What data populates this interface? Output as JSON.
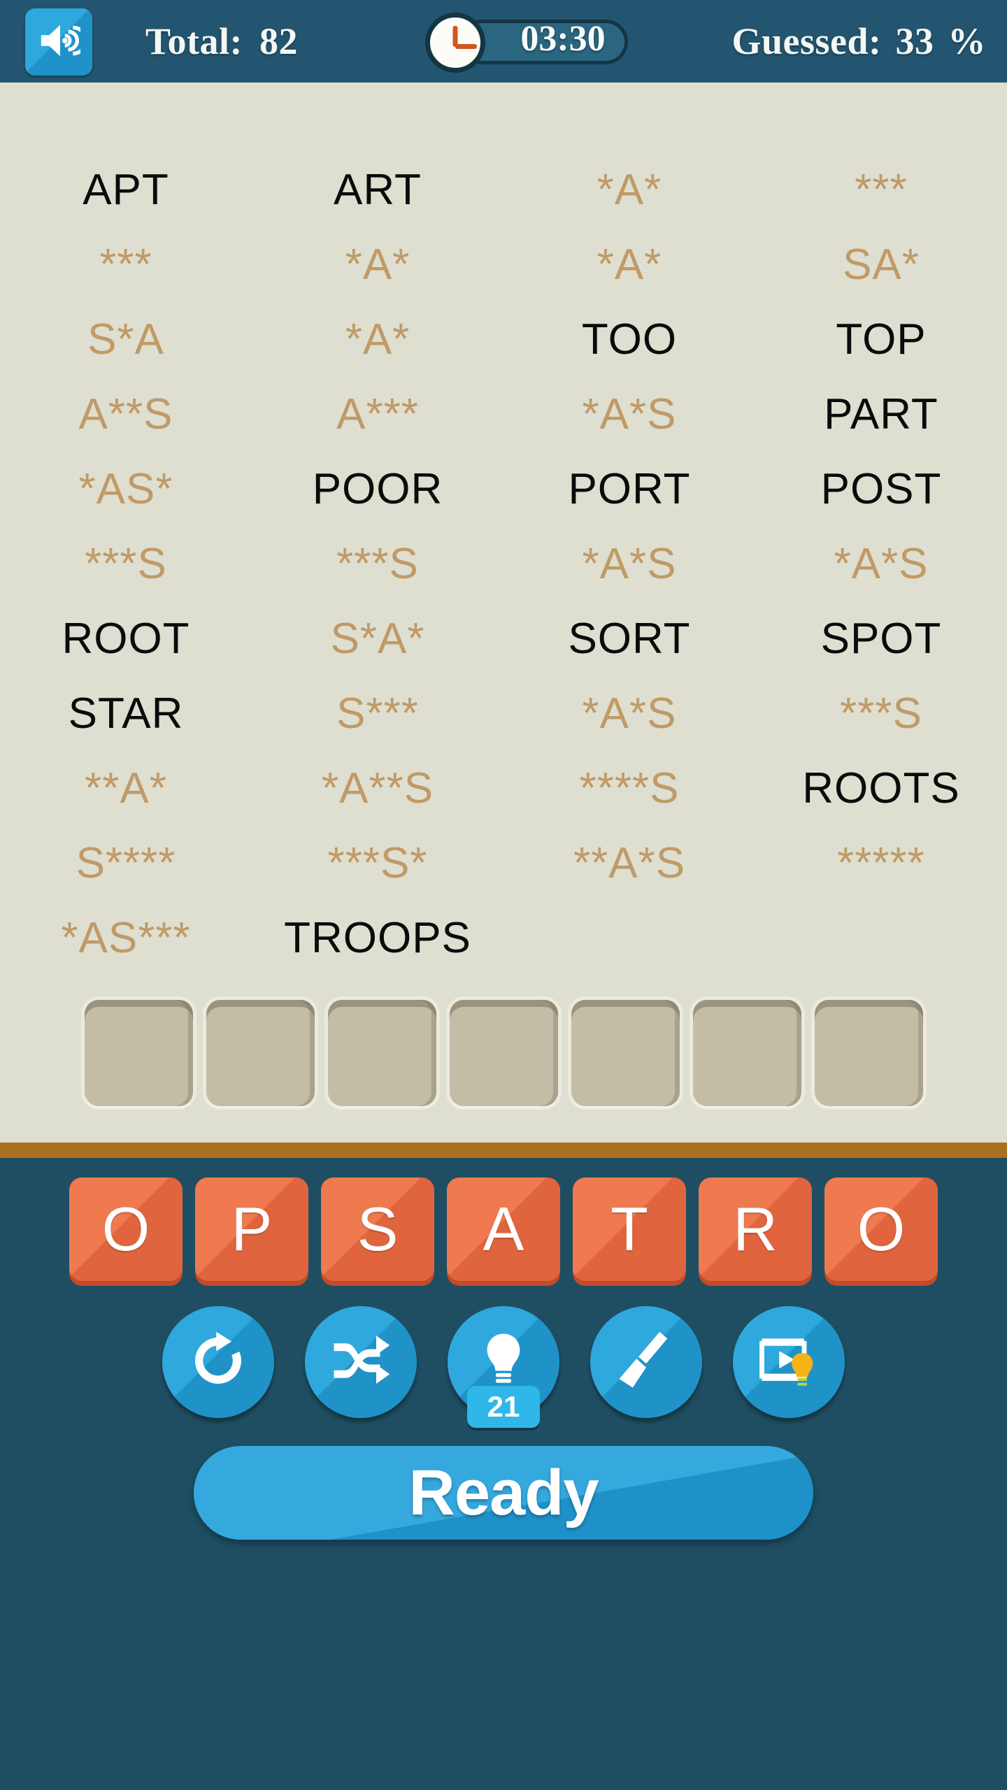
{
  "header": {
    "sound_icon": "speaker-on-icon",
    "total_label": "Total:",
    "total_value": "82",
    "clock_icon": "clock-icon",
    "timer_value": "03:30",
    "guessed_label": "Guessed:",
    "guessed_value": "33",
    "percent_symbol": "%"
  },
  "board": {
    "background_color": "#dedfd0",
    "solved_color": "#0b0b0b",
    "hidden_color": "#c09a67",
    "columns": 4,
    "words": [
      {
        "text": "APT",
        "solved": true
      },
      {
        "text": "ART",
        "solved": true
      },
      {
        "text": "*A*",
        "solved": false
      },
      {
        "text": "***",
        "solved": false
      },
      {
        "text": "***",
        "solved": false
      },
      {
        "text": "*A*",
        "solved": false
      },
      {
        "text": "*A*",
        "solved": false
      },
      {
        "text": "SA*",
        "solved": false
      },
      {
        "text": "S*A",
        "solved": false
      },
      {
        "text": "*A*",
        "solved": false
      },
      {
        "text": "TOO",
        "solved": true
      },
      {
        "text": "TOP",
        "solved": true
      },
      {
        "text": "A**S",
        "solved": false
      },
      {
        "text": "A***",
        "solved": false
      },
      {
        "text": "*A*S",
        "solved": false
      },
      {
        "text": "PART",
        "solved": true
      },
      {
        "text": "*AS*",
        "solved": false
      },
      {
        "text": "POOR",
        "solved": true
      },
      {
        "text": "PORT",
        "solved": true
      },
      {
        "text": "POST",
        "solved": true
      },
      {
        "text": "***S",
        "solved": false
      },
      {
        "text": "***S",
        "solved": false
      },
      {
        "text": "*A*S",
        "solved": false
      },
      {
        "text": "*A*S",
        "solved": false
      },
      {
        "text": "ROOT",
        "solved": true
      },
      {
        "text": "S*A*",
        "solved": false
      },
      {
        "text": "SORT",
        "solved": true
      },
      {
        "text": "SPOT",
        "solved": true
      },
      {
        "text": "STAR",
        "solved": true
      },
      {
        "text": "S***",
        "solved": false
      },
      {
        "text": "*A*S",
        "solved": false
      },
      {
        "text": "***S",
        "solved": false
      },
      {
        "text": "**A*",
        "solved": false
      },
      {
        "text": "*A**S",
        "solved": false
      },
      {
        "text": "****S",
        "solved": false
      },
      {
        "text": "ROOTS",
        "solved": true
      },
      {
        "text": "S****",
        "solved": false
      },
      {
        "text": "***S*",
        "solved": false
      },
      {
        "text": "**A*S",
        "solved": false
      },
      {
        "text": "*****",
        "solved": false
      },
      {
        "text": "*AS***",
        "solved": false
      },
      {
        "text": "TROOPS",
        "solved": true
      },
      {
        "text": "",
        "solved": false
      },
      {
        "text": "",
        "solved": false
      }
    ],
    "answer_slots": [
      "",
      "",
      "",
      "",
      "",
      "",
      ""
    ]
  },
  "bottom": {
    "letters": [
      "O",
      "P",
      "S",
      "A",
      "T",
      "R",
      "O"
    ],
    "letter_tile_color": "#ef7a50",
    "actions": [
      {
        "name": "refresh-button",
        "icon": "refresh-icon",
        "badge": null
      },
      {
        "name": "shuffle-button",
        "icon": "shuffle-icon",
        "badge": null
      },
      {
        "name": "hint-button",
        "icon": "lightbulb-icon",
        "badge": "21"
      },
      {
        "name": "clear-button",
        "icon": "broom-icon",
        "badge": null
      },
      {
        "name": "video-hint-button",
        "icon": "video-lightbulb-icon",
        "badge": null
      }
    ],
    "action_button_color": "#2fa8dd",
    "ready_label": "Ready",
    "ready_color": "#35a9de"
  }
}
